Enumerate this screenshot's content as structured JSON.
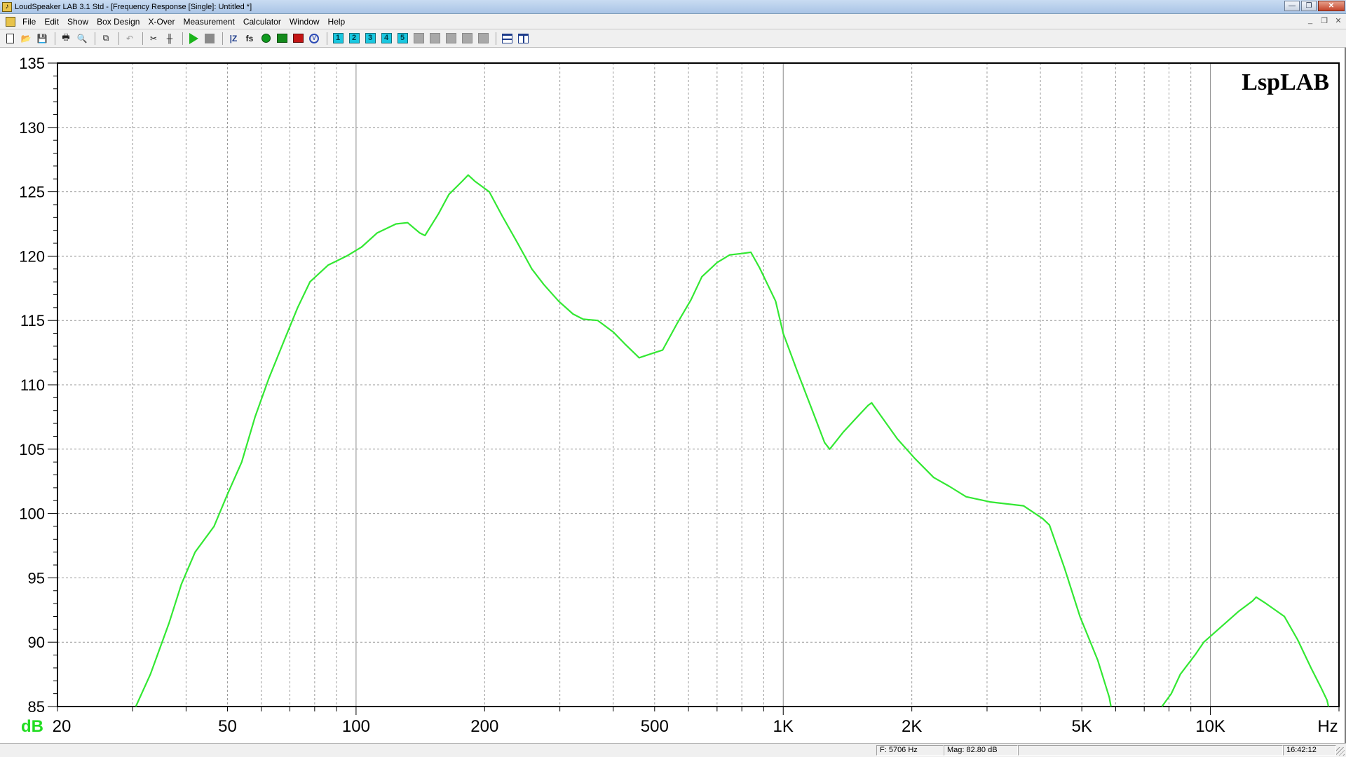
{
  "window": {
    "title": "LoudSpeaker LAB 3.1 Std - [Frequency Response [Single]: Untitled *]",
    "controls": [
      "minimize",
      "restore",
      "close"
    ]
  },
  "menubar": {
    "items": [
      "File",
      "Edit",
      "Show",
      "Box Design",
      "X-Over",
      "Measurement",
      "Calculator",
      "Window",
      "Help"
    ]
  },
  "toolbar": {
    "icons": [
      "new-icon",
      "open-icon",
      "save-icon",
      "print-icon",
      "print-preview-icon",
      "copy-icon",
      "undo-icon",
      "tools-icon",
      "equalizer-icon",
      "play-icon",
      "stop-icon",
      "impedance-icon",
      "fs-icon",
      "green-circle-icon",
      "green-chart-icon",
      "red-chart-icon",
      "v-icon"
    ],
    "numbered_buttons": [
      "1",
      "2",
      "3",
      "4",
      "5"
    ],
    "fs_label": "fs"
  },
  "chart_data": {
    "type": "line",
    "watermark": "LspLAB",
    "x_scale": "log",
    "xlim": [
      20,
      20000
    ],
    "ylim": [
      85,
      135
    ],
    "ylabel": "dB",
    "xlabel": "Hz",
    "grid": true,
    "y_ticks": [
      85,
      90,
      95,
      100,
      105,
      110,
      115,
      120,
      125,
      130,
      135
    ],
    "x_tick_labels": [
      {
        "value": 20,
        "label": "20"
      },
      {
        "value": 50,
        "label": "50"
      },
      {
        "value": 100,
        "label": "100"
      },
      {
        "value": 200,
        "label": "200"
      },
      {
        "value": 500,
        "label": "500"
      },
      {
        "value": 1000,
        "label": "1K"
      },
      {
        "value": 2000,
        "label": "2K"
      },
      {
        "value": 5000,
        "label": "5K"
      },
      {
        "value": 10000,
        "label": "10K"
      }
    ],
    "line_color": "#33e833",
    "series": [
      {
        "segments": [
          [
            [
              30.5,
              85
            ],
            [
              33,
              87.5
            ],
            [
              36.5,
              91.5
            ],
            [
              39,
              94.5
            ],
            [
              42,
              97
            ],
            [
              46.5,
              99
            ],
            [
              50,
              101.5
            ],
            [
              54,
              104
            ],
            [
              58,
              107.5
            ],
            [
              62.5,
              110.5
            ],
            [
              68,
              113.5
            ],
            [
              73,
              116
            ],
            [
              78,
              118
            ],
            [
              86,
              119.3
            ],
            [
              95,
              120
            ],
            [
              103,
              120.7
            ],
            [
              112,
              121.8
            ],
            [
              124,
              122.5
            ],
            [
              132,
              122.6
            ],
            [
              141,
              121.8
            ],
            [
              145,
              121.6
            ],
            [
              156,
              123.3
            ],
            [
              165,
              124.8
            ],
            [
              177,
              125.8
            ],
            [
              183,
              126.3
            ],
            [
              190,
              125.8
            ],
            [
              205,
              125
            ],
            [
              220,
              123.1
            ],
            [
              238,
              121.1
            ],
            [
              258,
              119
            ],
            [
              275,
              117.8
            ],
            [
              298,
              116.5
            ],
            [
              322,
              115.5
            ],
            [
              340,
              115.1
            ],
            [
              368,
              115
            ],
            [
              400,
              114.1
            ],
            [
              428,
              113.1
            ],
            [
              460,
              112.1
            ],
            [
              500,
              112.5
            ],
            [
              522,
              112.7
            ],
            [
              565,
              114.8
            ],
            [
              608,
              116.6
            ],
            [
              645,
              118.4
            ],
            [
              700,
              119.5
            ],
            [
              750,
              120.1
            ],
            [
              800,
              120.2
            ],
            [
              840,
              120.3
            ],
            [
              880,
              119.1
            ],
            [
              960,
              116.5
            ],
            [
              1000,
              114
            ],
            [
              1080,
              111
            ],
            [
              1170,
              108
            ],
            [
              1250,
              105.5
            ],
            [
              1285,
              105
            ],
            [
              1380,
              106.3
            ],
            [
              1490,
              107.5
            ],
            [
              1580,
              108.4
            ],
            [
              1610,
              108.6
            ],
            [
              1700,
              107.5
            ],
            [
              1850,
              105.8
            ],
            [
              2030,
              104.3
            ],
            [
              2250,
              102.8
            ],
            [
              2450,
              102.1
            ],
            [
              2680,
              101.3
            ],
            [
              3050,
              100.9
            ],
            [
              3650,
              100.6
            ],
            [
              4050,
              99.6
            ],
            [
              4200,
              99.1
            ],
            [
              4550,
              95.8
            ],
            [
              4950,
              92
            ],
            [
              5450,
              88.6
            ],
            [
              5800,
              85.7
            ],
            [
              5850,
              85
            ]
          ],
          [
            [
              7700,
              85
            ],
            [
              8100,
              86
            ],
            [
              8500,
              87.5
            ],
            [
              9200,
              89
            ],
            [
              9650,
              90
            ],
            [
              10600,
              91.2
            ],
            [
              11650,
              92.4
            ],
            [
              12550,
              93.2
            ],
            [
              12800,
              93.5
            ],
            [
              13500,
              93
            ],
            [
              14900,
              92
            ],
            [
              16000,
              90.2
            ],
            [
              17200,
              88
            ],
            [
              18200,
              86.4
            ],
            [
              18750,
              85.5
            ],
            [
              18900,
              85
            ]
          ]
        ]
      }
    ]
  },
  "statusbar": {
    "frequency": "F: 5706 Hz",
    "magnitude": "Mag: 82.80 dB",
    "time": "16:42:12"
  }
}
